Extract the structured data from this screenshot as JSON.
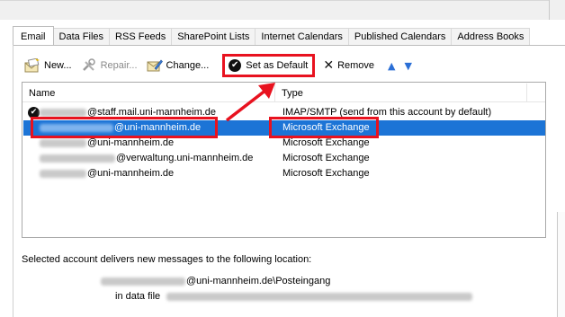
{
  "tabs": [
    {
      "label": "Email",
      "active": true
    },
    {
      "label": "Data Files",
      "active": false
    },
    {
      "label": "RSS Feeds",
      "active": false
    },
    {
      "label": "SharePoint Lists",
      "active": false
    },
    {
      "label": "Internet Calendars",
      "active": false
    },
    {
      "label": "Published Calendars",
      "active": false
    },
    {
      "label": "Address Books",
      "active": false
    }
  ],
  "toolbar": {
    "new_label": "New...",
    "repair_label": "Repair...",
    "change_label": "Change...",
    "set_default_label": "Set as Default",
    "remove_label": "Remove"
  },
  "accounts": {
    "columns": {
      "name": "Name",
      "type": "Type"
    },
    "rows": [
      {
        "name": "@staff.mail.uni-mannheim.de",
        "type": "IMAP/SMTP (send from this account by default)",
        "default": true,
        "selected": false
      },
      {
        "name": "@uni-mannheim.de",
        "type": "Microsoft Exchange",
        "default": false,
        "selected": true
      },
      {
        "name": "@uni-mannheim.de",
        "type": "Microsoft Exchange",
        "default": false,
        "selected": false
      },
      {
        "name": "@verwaltung.uni-mannheim.de",
        "type": "Microsoft Exchange",
        "default": false,
        "selected": false
      },
      {
        "name": "@uni-mannheim.de",
        "type": "Microsoft Exchange",
        "default": false,
        "selected": false
      }
    ]
  },
  "delivery": {
    "note": "Selected account delivers new messages to the following location:",
    "location": "@uni-mannheim.de\\Posteingang",
    "data_file_label": "in data file"
  },
  "colors": {
    "selection": "#1c74d6",
    "highlight": "#e8121f",
    "arrow_buttons": "#2b6fd6"
  }
}
